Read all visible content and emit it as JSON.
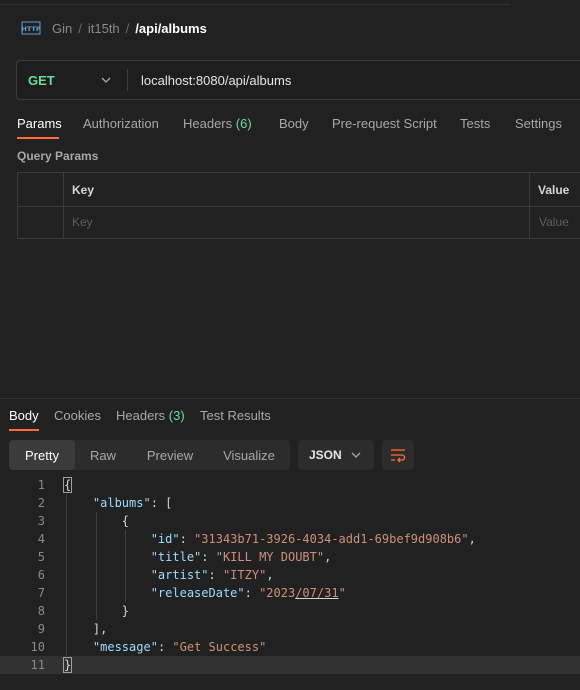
{
  "breadcrumb": {
    "icon": "http-icon",
    "items": [
      "Gin",
      "it15th"
    ],
    "current": "/api/albums"
  },
  "request": {
    "method": "GET",
    "url": "localhost:8080/api/albums"
  },
  "request_tabs": [
    {
      "label": "Params",
      "active": true
    },
    {
      "label": "Authorization"
    },
    {
      "label": "Headers",
      "count": "(6)"
    },
    {
      "label": "Body"
    },
    {
      "label": "Pre-request Script"
    },
    {
      "label": "Tests"
    },
    {
      "label": "Settings"
    }
  ],
  "query_params": {
    "title": "Query Params",
    "columns": [
      "Key",
      "Value"
    ],
    "placeholder": {
      "key": "Key",
      "value": "Value"
    }
  },
  "response_tabs": [
    {
      "label": "Body",
      "active": true
    },
    {
      "label": "Cookies"
    },
    {
      "label": "Headers",
      "count": "(3)"
    },
    {
      "label": "Test Results"
    }
  ],
  "view_modes": [
    "Pretty",
    "Raw",
    "Preview",
    "Visualize"
  ],
  "view_selected": "Pretty",
  "format": "JSON",
  "code": {
    "line_numbers": [
      "1",
      "2",
      "3",
      "4",
      "5",
      "6",
      "7",
      "8",
      "9",
      "10",
      "11"
    ],
    "albums_key": "\"albums\"",
    "id_key": "\"id\"",
    "id_val": "\"31343b71-3926-4034-add1-69bef9d908b6\"",
    "title_key": "\"title\"",
    "title_val": "\"KILL MY DOUBT\"",
    "artist_key": "\"artist\"",
    "artist_val": "\"ITZY\"",
    "release_key": "\"releaseDate\"",
    "release_val_a": "\"2023",
    "release_val_b": "/07/31",
    "release_val_c": "\"",
    "message_key": "\"message\"",
    "message_val": "\"Get Success\""
  },
  "colors": {
    "accent": "#ff6c37",
    "method": "#6bdd9a",
    "json_key": "#9cdcfe",
    "json_string": "#ce9178"
  }
}
